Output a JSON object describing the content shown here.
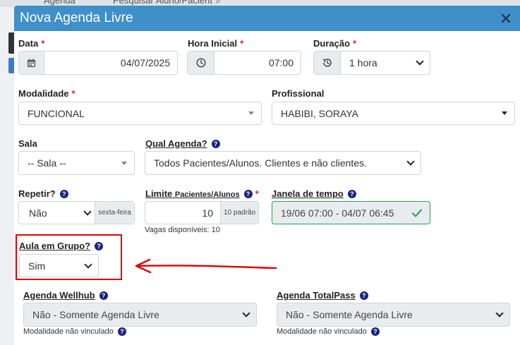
{
  "background": {
    "tab1": "Agenda",
    "tab2": "Pesquisar Aluno/Pacient"
  },
  "modal": {
    "title": "Nova Agenda Livre",
    "close_icon": "close-icon"
  },
  "fields": {
    "data": {
      "label": "Data",
      "value": "04/07/2025",
      "icon": "calendar-icon"
    },
    "hora_inicial": {
      "label": "Hora Inicial",
      "value": "07:00",
      "icon": "clock-icon"
    },
    "duracao": {
      "label": "Duração",
      "value": "1 hora",
      "icon": "history-icon"
    },
    "modalidade": {
      "label": "Modalidade",
      "value": "FUNCIONAL"
    },
    "profissional": {
      "label": "Profissional",
      "value": "HABIBI, SORAYA"
    },
    "sala": {
      "label": "Sala",
      "value": "-- Sala --"
    },
    "qual_agenda": {
      "label": "Qual Agenda?",
      "value": "Todos Pacientes/Alunos. Clientes e não clientes."
    },
    "repetir": {
      "label": "Repetir?",
      "value": "Não",
      "addon": "sexta-feira"
    },
    "limite": {
      "label": "Limite",
      "label_sub": "Pacientes/Alunos",
      "value": "10",
      "addon": "10 padrão",
      "note": "Vagas disponíveis: 10"
    },
    "janela": {
      "label": "Janela de tempo",
      "value": "19/06 07:00 - 04/07 06:45"
    },
    "aula_grupo": {
      "label": "Aula em Grupo?",
      "value": "Sim"
    },
    "wellhub": {
      "label": "Agenda Wellhub",
      "value": "Não - Somente Agenda Livre",
      "note": "Modalidade não vinculado"
    },
    "totalpass": {
      "label": "Agenda TotalPass",
      "value": "Não - Somente Agenda Livre",
      "note": "Modalidade não vinculado"
    }
  },
  "colors": {
    "header": "#3f8fc9",
    "required": "#e02424",
    "success": "#28a745",
    "annotation": "#e00000"
  }
}
